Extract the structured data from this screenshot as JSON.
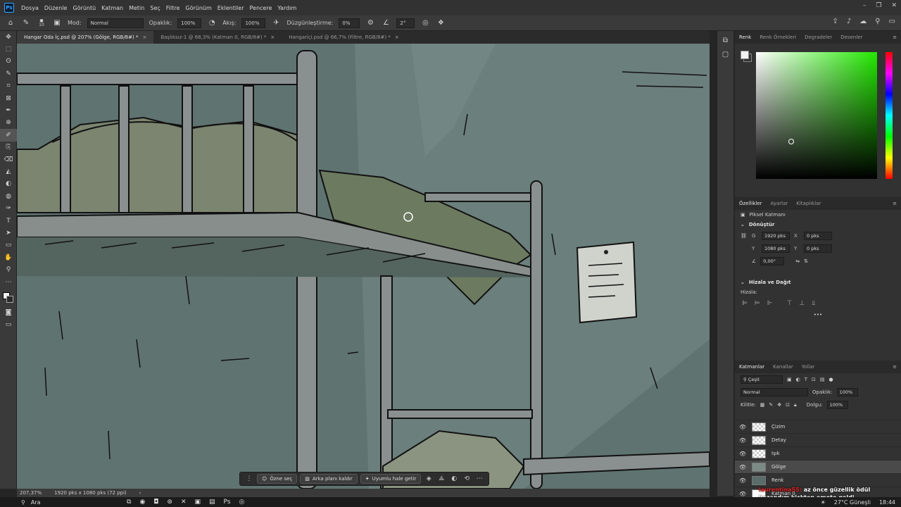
{
  "app": {
    "logo": "Ps",
    "menu": [
      "Dosya",
      "Düzenle",
      "Görüntü",
      "Katman",
      "Metin",
      "Seç",
      "Filtre",
      "Görünüm",
      "Eklentiler",
      "Pencere",
      "Yardım"
    ],
    "window_controls": [
      "–",
      "❐",
      "✕"
    ]
  },
  "options": {
    "brush_size": "10",
    "mode_label": "Mod:",
    "mode_value": "Normal",
    "opacity_label": "Opaklık:",
    "opacity_value": "100%",
    "flow_label": "Akış:",
    "flow_value": "100%",
    "smoothing_label": "Düzgünleştirme:",
    "smoothing_value": "0%",
    "angle_value": "2°"
  },
  "tabs": [
    {
      "label": "Hangar Oda İç.psd @ 207% (Gölge, RGB/8#) *",
      "active": true
    },
    {
      "label": "Başlıksız-1 @ 68,3% (Katman 0, RGB/8#) *",
      "active": false
    },
    {
      "label": "Hangariçi.psd @ 66,7% (Filtre, RGB/8#) *",
      "active": false
    }
  ],
  "tools": [
    "✥",
    "⬚",
    "ʘ",
    "✎",
    "⌗",
    "⊠",
    "✒",
    "⊕",
    "✐",
    "⎘",
    "⌫",
    "◭",
    "◐",
    "◍",
    "✑",
    "T",
    "➤",
    "▭",
    "✋",
    "⚲",
    "⋯"
  ],
  "context_bar": {
    "select_subject": "Özne seç",
    "remove_bg": "Arka planı kaldır",
    "generative_fill": "Uyumlu hale getir",
    "more": "⋯"
  },
  "status": {
    "zoom": "207,37%",
    "doc_size": "1920 pks x 1080 pks (72 ppi)"
  },
  "color_panel": {
    "tabs": [
      "Renk",
      "Renk Örnekleri",
      "Degradeler",
      "Desenler"
    ],
    "active_tab": "Renk"
  },
  "properties_panel": {
    "tabs": [
      "Özellikler",
      "Ayarlar",
      "Kitaplıklar"
    ],
    "layer_type": "Piksel Katmanı",
    "transform_title": "Dönüştür",
    "w_label": "G",
    "w_value": "1920 pks",
    "h_label": "Y",
    "h_value": "1080 pks",
    "x_label": "X",
    "x_value": "0 pks",
    "y_label": "Y",
    "y_value": "0 pks",
    "angle": "0,00°",
    "align_title": "Hizala ve Dağıt",
    "align_label": "Hizala:"
  },
  "layers_panel": {
    "tabs": [
      "Katmanlar",
      "Kanallar",
      "Yollar"
    ],
    "filter_kind": "Çeşit",
    "blend_mode": "Normal",
    "opacity_label": "Opaklık:",
    "opacity_value": "100%",
    "lock_label": "Kilitle:",
    "fill_label": "Dolgu:",
    "fill_value": "100%",
    "layers": [
      {
        "name": "Çizim",
        "thumb": "checker",
        "selected": false
      },
      {
        "name": "Detay",
        "thumb": "checker",
        "selected": false
      },
      {
        "name": "Işık",
        "thumb": "checker",
        "selected": false
      },
      {
        "name": "Gölge",
        "thumb": "sketch",
        "selected": true
      },
      {
        "name": "Renk",
        "thumb": "color",
        "selected": false
      },
      {
        "name": "Katman 0",
        "thumb": "white",
        "selected": false
      }
    ]
  },
  "chat": {
    "user": "laurentina55:",
    "message": "az önce güzellik ödül kazandım kickten emote geldi"
  },
  "taskbar": {
    "search_label": "Ara",
    "weather": "27°C Güneşli",
    "time": "18:44"
  },
  "colors": {
    "canvas_bg": "#5f7370",
    "panel_bg": "#323232",
    "accent": "#31a8ff"
  }
}
